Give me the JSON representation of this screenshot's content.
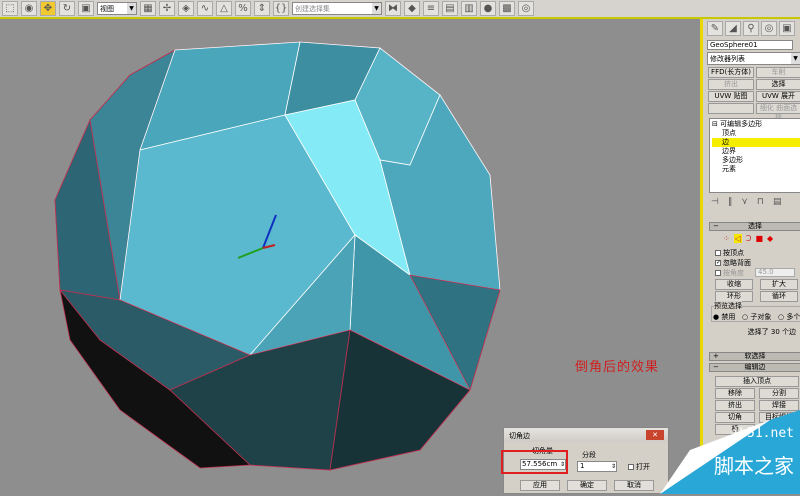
{
  "toolbar": {
    "view_combo": "视图",
    "selset_combo": "创建选择集"
  },
  "panel": {
    "object_name": "GeoSphere01",
    "modifier_list": "修改器列表",
    "buttons": [
      "FFD(长方体)",
      "车削",
      "挤出",
      "选择",
      "UVW 贴图",
      "UVW 展开",
      "",
      "细化 曲面选择"
    ],
    "stack": {
      "root": "可编辑多边形",
      "items": [
        "顶点",
        "边",
        "边界",
        "多边形",
        "元素"
      ],
      "selected": "边"
    },
    "selection_rollout": "选择",
    "by_vertex": "按顶点",
    "ignore_backfacing": "忽略背面",
    "by_angle": "按角度",
    "angle_value": "45.0",
    "shrink": "收缩",
    "grow": "扩大",
    "ring": "环形",
    "loop": "循环",
    "preview_label": "预览选择",
    "preview_options": [
      "禁用",
      "子对象",
      "多个"
    ],
    "selection_status": "选择了 30 个边",
    "soft_selection": "软选择",
    "edit_edges": "编辑边",
    "insert_vertex": "插入顶点",
    "remove": "移除",
    "split": "分割",
    "extrude": "挤出",
    "weld": "焊接",
    "chamfer": "切角",
    "target_weld": "目标焊接",
    "bridge": "桥"
  },
  "annotation": "倒角后的效果",
  "dialog": {
    "title": "切角边",
    "close": "✕",
    "amount_label": "切角量",
    "amount_value": "57.556cm",
    "segments_label": "分段",
    "segments_value": "1",
    "open_label": "打开",
    "apply": "应用",
    "ok": "确定",
    "cancel": "取消"
  },
  "watermark": {
    "url": "jb51.net",
    "name": "脚本之家"
  }
}
